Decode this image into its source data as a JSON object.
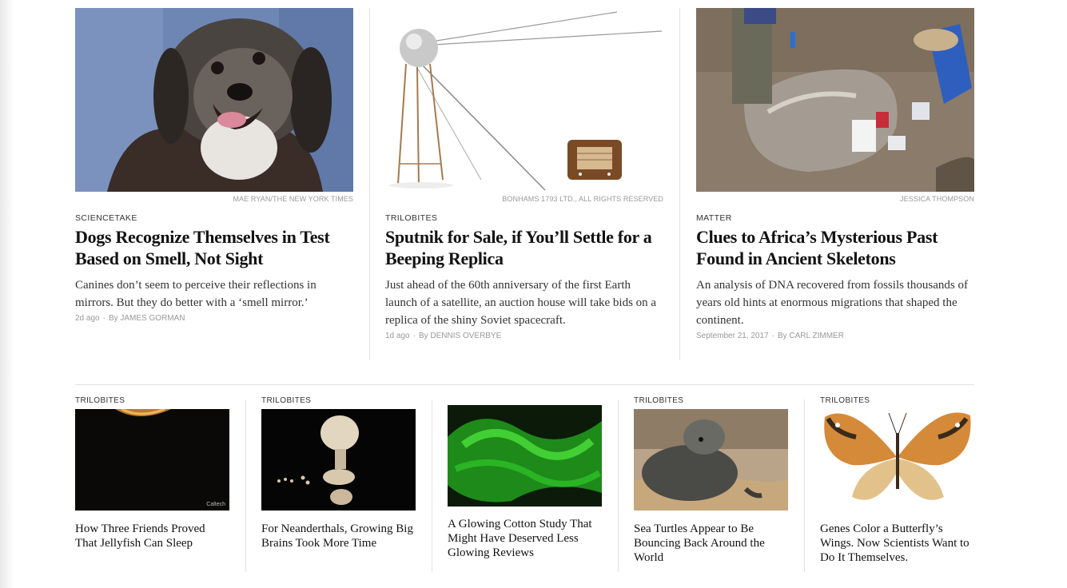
{
  "top_stories": [
    {
      "credit": "MAE RYAN/THE NEW YORK TIMES",
      "kicker": "SCIENCETAKE",
      "headline": "Dogs Recognize Themselves in Test Based on Smell, Not Sight",
      "summary": "Canines don’t seem to perceive their reflections in mirrors. But they do better with a ‘smell mirror.’",
      "time": "2d ago",
      "byline": "By JAMES GORMAN"
    },
    {
      "credit": "BONHAMS 1793 LTD., ALL RIGHTS RESERVED",
      "kicker": "TRILOBITES",
      "headline": "Sputnik for Sale, if You’ll Settle for a Beeping Replica",
      "summary": "Just ahead of the 60th anniversary of the first Earth launch of a satellite, an auction house will take bids on a replica of the shiny Soviet spacecraft.",
      "time": "1d ago",
      "byline": "By DENNIS OVERBYE"
    },
    {
      "credit": "JESSICA THOMPSON",
      "kicker": "MATTER",
      "headline": "Clues to Africa’s Mysterious Past Found in Ancient Skeletons",
      "summary": "An analysis of DNA recovered from fossils thousands of years old hints at enormous migrations that shaped the continent.",
      "time": "September 21, 2017",
      "byline": "By CARL ZIMMER"
    }
  ],
  "bottom_stories": [
    {
      "kicker": "TRILOBITES",
      "image_watermark": "Caltech",
      "headline": "How Three Friends Proved That Jellyfish Can Sleep"
    },
    {
      "kicker": "TRILOBITES",
      "headline": "For Neanderthals, Growing Big Brains Took More Time"
    },
    {
      "kicker": "",
      "headline": "A Glowing Cotton Study That Might Have Deserved Less Glowing Reviews"
    },
    {
      "kicker": "TRILOBITES",
      "headline": "Sea Turtles Appear to Be Bouncing Back Around the World"
    },
    {
      "kicker": "TRILOBITES",
      "headline": "Genes Color a Butterfly’s Wings. Now Scientists Want to Do It Themselves."
    }
  ],
  "byline_separator": "·",
  "icons": [
    "dog-photo",
    "sputnik-photo",
    "skeleton-dig-photo",
    "jellyfish-photo",
    "neanderthal-skull-photo",
    "glowing-cotton-photo",
    "sea-turtle-photo",
    "butterfly-photo"
  ]
}
